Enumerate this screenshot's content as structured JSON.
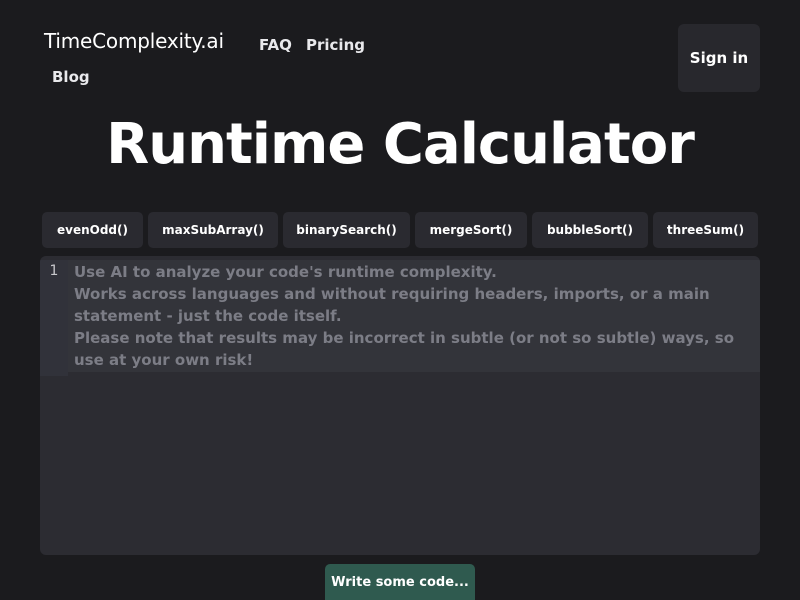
{
  "header": {
    "brand": "TimeComplexity.ai",
    "nav": [
      {
        "label": "FAQ"
      },
      {
        "label": "Pricing"
      },
      {
        "label": "Blog"
      }
    ],
    "sign_in": "Sign in"
  },
  "title": "Runtime Calculator",
  "examples": [
    {
      "label": "evenOdd()"
    },
    {
      "label": "maxSubArray()"
    },
    {
      "label": "binarySearch()"
    },
    {
      "label": "mergeSort()"
    },
    {
      "label": "bubbleSort()"
    },
    {
      "label": "threeSum()"
    }
  ],
  "editor": {
    "line_number": "1",
    "value": "",
    "placeholder": "Use AI to analyze your code's runtime complexity.\nWorks across languages and without requiring headers, imports, or a main statement - just the code itself.\nPlease note that results may be incorrect in subtle (or not so subtle) ways, so use at your own risk!"
  },
  "submit": {
    "label": "Write some code..."
  },
  "colors": {
    "background": "#1b1b1e",
    "button_bg": "#2a2a30",
    "editor_bg": "#2c2c32",
    "placeholder": "#7c7d86",
    "submit_bg": "#2f5a4f"
  }
}
